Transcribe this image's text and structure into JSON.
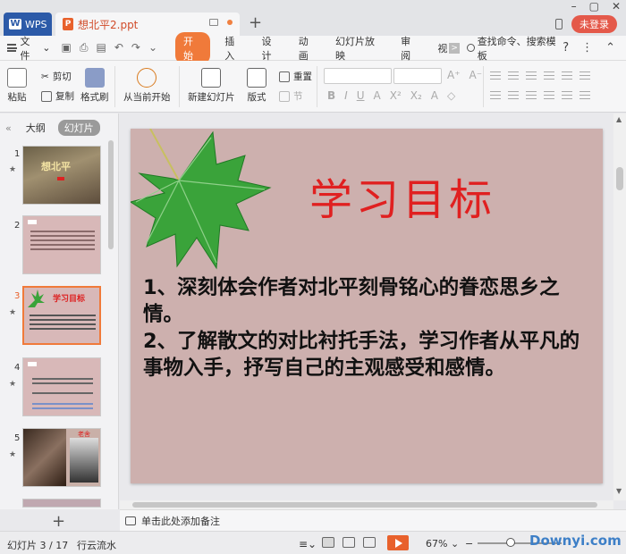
{
  "titlebar": {
    "app_name": "WPS",
    "doc_tab": "想北平2.ppt",
    "login": "未登录"
  },
  "menubar": {
    "file": "文件",
    "items": [
      "开始",
      "插入",
      "设计",
      "动画",
      "幻灯片放映",
      "审阅",
      "视"
    ],
    "active": "开始",
    "search": "查找命令、搜索模板"
  },
  "toolbar": {
    "paste": "粘贴",
    "cut": "剪切",
    "copy": "复制",
    "format_painter": "格式刷",
    "from_current": "从当前开始",
    "new_slide": "新建幻灯片",
    "layout": "版式",
    "reset": "重置",
    "section": "节"
  },
  "left_panel": {
    "tab_outline": "大纲",
    "tab_slides": "幻灯片",
    "thumbnails": [
      {
        "num": "1",
        "title": "想北平"
      },
      {
        "num": "2",
        "title": ""
      },
      {
        "num": "3",
        "title": "学习目标"
      },
      {
        "num": "4",
        "title": ""
      },
      {
        "num": "5",
        "title": "老舍"
      }
    ],
    "selected": 3
  },
  "slide": {
    "title": "学习目标",
    "points": [
      "1、深刻体会作者对北平刻骨铭心的眷恋思乡之情。",
      "2、了解散文的对比衬托手法，学习作者从平凡的事物入手，抒写自己的主观感受和感情。"
    ],
    "colors": {
      "title": "#e02020",
      "background": "#cdb0ae",
      "leaf": "#3aa33a"
    }
  },
  "notes": {
    "placeholder": "单击此处添加备注"
  },
  "statusbar": {
    "slide_counter": "幻灯片 3 / 17",
    "theme": "行云流水",
    "zoom": "67%",
    "watermark": "Downyi.com"
  },
  "accent": "#f07a3a"
}
